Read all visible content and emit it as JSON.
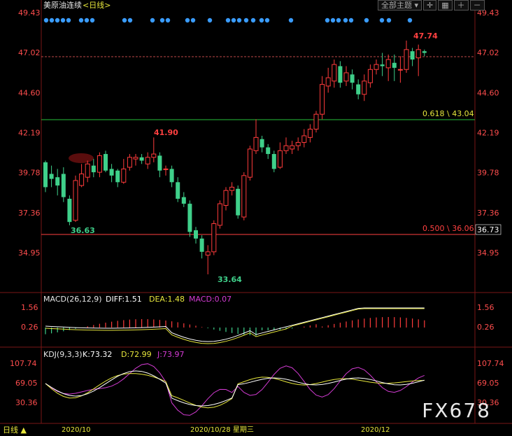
{
  "header": {
    "instrument": "美原油连续",
    "period": "<日线>",
    "theme_button": "全部主题",
    "theme_arrow": "▾"
  },
  "colors": {
    "up": "#ff3b3b",
    "down": "#3fd08a",
    "price_axis": "#ff4d4d",
    "fib_line": "#29c03a",
    "support_line": "#ff4040",
    "dots": "#3a9cff",
    "macd_text": "#ff3b3b",
    "diff": "#ffffff",
    "dea": "#e6e63c",
    "macd": "#d33bd3",
    "kdj_k": "#ffffff",
    "kdj_d": "#e6e63c",
    "kdj_j": "#d33bd3"
  },
  "price_axis": {
    "left_labels": [
      "49.43",
      "47.02",
      "44.60",
      "42.19",
      "39.78",
      "37.36",
      "34.95"
    ],
    "right_labels": [
      "49.43",
      "47.02",
      "44.60",
      "42.19",
      "39.78",
      "37.36",
      "34.95"
    ],
    "current_price": "36.73"
  },
  "annotations": {
    "high_label": "47.74",
    "peak_label": "41.90",
    "low_label_1": "36.63",
    "low_label_2": "33.64",
    "fib_618": "0.618 \\ 43.04",
    "fib_500": "0.500 \\ 36.06"
  },
  "macd": {
    "title": "MACD(26,12,9)",
    "diff": "DIFF:1.51",
    "dea": "DEA:1.48",
    "macd": "MACD:0.07",
    "axis_labels": [
      "1.56",
      "0.26"
    ]
  },
  "kdj": {
    "title": "KDJ(9,3,3)",
    "k": "K:73.32",
    "d": "D:72.99",
    "j": "J:73.97",
    "axis_labels": [
      "107.74",
      "69.05",
      "30.36"
    ]
  },
  "footer": {
    "period_button": "日线 ▲",
    "date_labels": [
      "2020/10",
      "2020/10/28 星期三",
      "2020/12"
    ]
  },
  "watermark": "FX678",
  "chart_data": {
    "type": "candlestick",
    "ylim": [
      33.0,
      49.43
    ],
    "candles": [
      {
        "o": 40.4,
        "c": 38.9,
        "h": 40.5,
        "l": 38.6
      },
      {
        "o": 39.7,
        "c": 39.4,
        "h": 40.2,
        "l": 38.9
      },
      {
        "o": 39.5,
        "c": 39.0,
        "h": 40.0,
        "l": 38.4
      },
      {
        "o": 39.7,
        "c": 38.3,
        "h": 40.1,
        "l": 38.0
      },
      {
        "o": 38.2,
        "c": 36.8,
        "h": 38.4,
        "l": 36.6
      },
      {
        "o": 36.9,
        "c": 39.3,
        "h": 39.6,
        "l": 36.8
      },
      {
        "o": 39.0,
        "c": 39.7,
        "h": 40.3,
        "l": 38.9
      },
      {
        "o": 39.5,
        "c": 40.3,
        "h": 40.5,
        "l": 39.2
      },
      {
        "o": 40.2,
        "c": 39.8,
        "h": 40.6,
        "l": 39.5
      },
      {
        "o": 39.8,
        "c": 40.8,
        "h": 41.0,
        "l": 39.5
      },
      {
        "o": 40.9,
        "c": 39.9,
        "h": 41.1,
        "l": 39.8
      },
      {
        "o": 40.0,
        "c": 39.6,
        "h": 40.3,
        "l": 39.2
      },
      {
        "o": 39.9,
        "c": 39.2,
        "h": 40.0,
        "l": 38.9
      },
      {
        "o": 39.2,
        "c": 40.0,
        "h": 40.6,
        "l": 39.1
      },
      {
        "o": 40.1,
        "c": 40.7,
        "h": 40.9,
        "l": 39.9
      },
      {
        "o": 40.6,
        "c": 40.7,
        "h": 40.9,
        "l": 40.2
      },
      {
        "o": 40.7,
        "c": 40.5,
        "h": 40.9,
        "l": 40.3
      },
      {
        "o": 40.3,
        "c": 40.7,
        "h": 41.0,
        "l": 40.0
      },
      {
        "o": 40.7,
        "c": 40.9,
        "h": 41.9,
        "l": 40.4
      },
      {
        "o": 40.8,
        "c": 39.9,
        "h": 41.0,
        "l": 39.5
      },
      {
        "o": 40.0,
        "c": 40.0,
        "h": 40.2,
        "l": 39.6
      },
      {
        "o": 40.0,
        "c": 39.2,
        "h": 40.2,
        "l": 38.9
      },
      {
        "o": 39.2,
        "c": 38.2,
        "h": 39.5,
        "l": 38.0
      },
      {
        "o": 38.3,
        "c": 37.9,
        "h": 38.6,
        "l": 37.7
      },
      {
        "o": 37.9,
        "c": 36.2,
        "h": 38.1,
        "l": 35.9
      },
      {
        "o": 36.3,
        "c": 35.8,
        "h": 36.5,
        "l": 35.5
      },
      {
        "o": 35.8,
        "c": 35.0,
        "h": 36.0,
        "l": 34.6
      },
      {
        "o": 34.8,
        "c": 35.0,
        "h": 35.4,
        "l": 33.64
      },
      {
        "o": 35.0,
        "c": 36.7,
        "h": 36.9,
        "l": 34.8
      },
      {
        "o": 36.6,
        "c": 37.9,
        "h": 38.1,
        "l": 36.4
      },
      {
        "o": 37.8,
        "c": 38.7,
        "h": 38.9,
        "l": 37.5
      },
      {
        "o": 38.7,
        "c": 38.9,
        "h": 39.2,
        "l": 38.4
      },
      {
        "o": 38.8,
        "c": 37.2,
        "h": 39.0,
        "l": 37.0
      },
      {
        "o": 37.1,
        "c": 39.6,
        "h": 39.8,
        "l": 36.9
      },
      {
        "o": 39.5,
        "c": 41.2,
        "h": 41.4,
        "l": 39.3
      },
      {
        "o": 41.1,
        "c": 41.9,
        "h": 43.0,
        "l": 40.9
      },
      {
        "o": 41.8,
        "c": 41.3,
        "h": 42.0,
        "l": 41.0
      },
      {
        "o": 41.3,
        "c": 40.9,
        "h": 41.5,
        "l": 40.6
      },
      {
        "o": 40.9,
        "c": 40.0,
        "h": 41.1,
        "l": 39.8
      },
      {
        "o": 40.1,
        "c": 41.1,
        "h": 41.6,
        "l": 40.0
      },
      {
        "o": 41.1,
        "c": 41.4,
        "h": 41.9,
        "l": 40.9
      },
      {
        "o": 41.2,
        "c": 41.4,
        "h": 41.7,
        "l": 40.9
      },
      {
        "o": 41.4,
        "c": 41.6,
        "h": 41.9,
        "l": 41.1
      },
      {
        "o": 41.6,
        "c": 42.0,
        "h": 42.4,
        "l": 41.3
      },
      {
        "o": 41.9,
        "c": 42.4,
        "h": 42.7,
        "l": 41.6
      },
      {
        "o": 42.4,
        "c": 43.3,
        "h": 43.5,
        "l": 42.2
      },
      {
        "o": 43.3,
        "c": 45.1,
        "h": 45.6,
        "l": 43.0
      },
      {
        "o": 45.0,
        "c": 45.5,
        "h": 46.1,
        "l": 44.6
      },
      {
        "o": 45.3,
        "c": 46.3,
        "h": 46.6,
        "l": 44.9
      },
      {
        "o": 46.2,
        "c": 45.2,
        "h": 46.5,
        "l": 44.9
      },
      {
        "o": 45.3,
        "c": 45.8,
        "h": 46.2,
        "l": 45.0
      },
      {
        "o": 45.7,
        "c": 45.2,
        "h": 46.0,
        "l": 44.8
      },
      {
        "o": 45.1,
        "c": 44.5,
        "h": 45.4,
        "l": 44.2
      },
      {
        "o": 44.5,
        "c": 45.3,
        "h": 45.7,
        "l": 44.1
      },
      {
        "o": 45.2,
        "c": 46.0,
        "h": 46.3,
        "l": 44.9
      },
      {
        "o": 46.0,
        "c": 46.3,
        "h": 46.6,
        "l": 45.7
      },
      {
        "o": 46.3,
        "c": 46.2,
        "h": 47.0,
        "l": 45.6
      },
      {
        "o": 46.1,
        "c": 46.6,
        "h": 46.9,
        "l": 45.3
      },
      {
        "o": 46.4,
        "c": 46.1,
        "h": 46.9,
        "l": 45.3
      },
      {
        "o": 46.0,
        "c": 46.0,
        "h": 46.8,
        "l": 45.2
      },
      {
        "o": 46.0,
        "c": 47.2,
        "h": 47.74,
        "l": 45.8
      },
      {
        "o": 47.1,
        "c": 46.6,
        "h": 47.3,
        "l": 46.2
      },
      {
        "o": 46.7,
        "c": 47.2,
        "h": 47.5,
        "l": 45.6
      },
      {
        "o": 47.1,
        "c": 47.0,
        "h": 47.2,
        "l": 46.8
      }
    ]
  }
}
